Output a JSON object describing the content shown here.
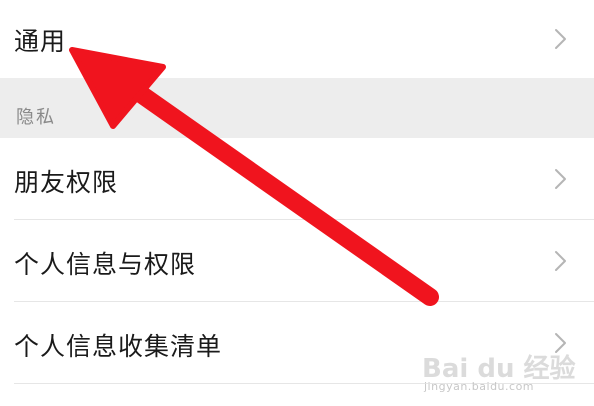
{
  "settings": {
    "general": {
      "label": "通用"
    },
    "privacy_section": {
      "label": "隐私"
    },
    "items": [
      {
        "label": "朋友权限"
      },
      {
        "label": "个人信息与权限"
      },
      {
        "label": "个人信息收集清单"
      }
    ]
  },
  "watermark": {
    "logo": "Bai du 经验",
    "url": "jingyan.baidu.com"
  },
  "icons": {
    "row_chevron": "chevron-right-icon",
    "annotation": "red-arrow-icon"
  },
  "colors": {
    "background": "#ffffff",
    "section_background": "#ededed",
    "text": "#1a1a1a",
    "section_text": "#8a8a8a",
    "chevron": "#b5b5b5",
    "divider": "#e6e6e6",
    "annotation_arrow": "#f0141e"
  }
}
